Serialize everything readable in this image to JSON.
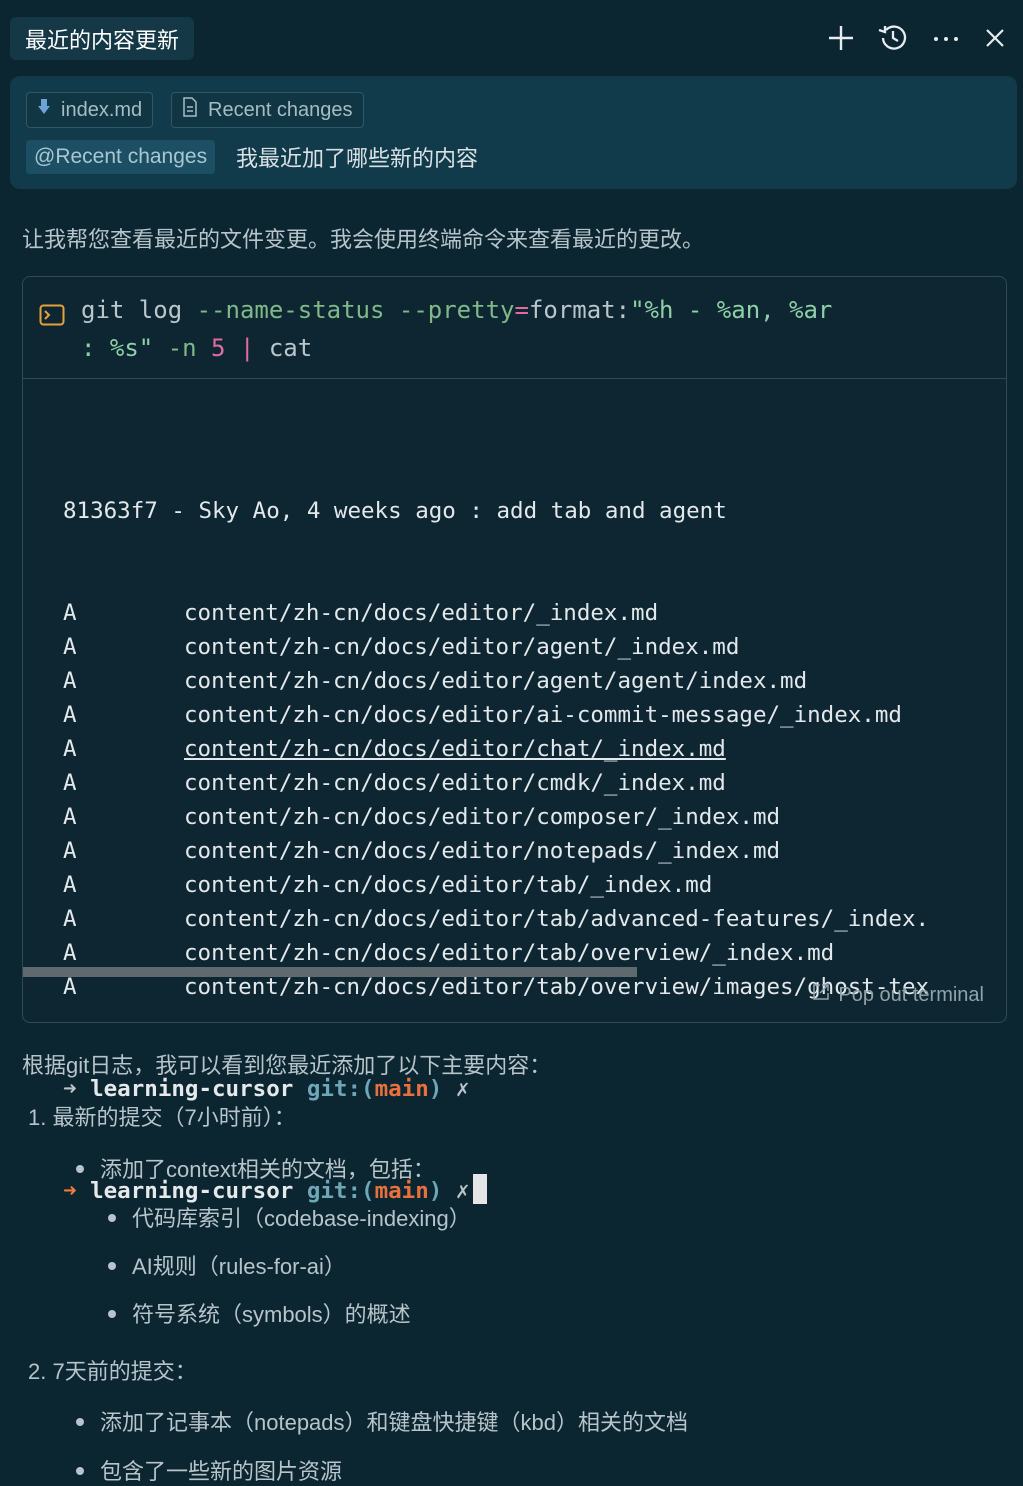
{
  "header": {
    "title": "最近的内容更新",
    "icons": [
      "plus-icon",
      "history-icon",
      "more-icon",
      "close-icon"
    ]
  },
  "user_message": {
    "chips": [
      {
        "icon": "arrow-down-icon",
        "label": "index.md"
      },
      {
        "icon": "document-icon",
        "label": "Recent changes"
      }
    ],
    "mention": "@Recent changes",
    "text": "我最近加了哪些新的内容"
  },
  "assistant": {
    "intro": "让我帮您查看最近的文件变更。我会使用终端命令来查看最近的更改。",
    "terminal": {
      "cmd_line1_a": "git log ",
      "cmd_line1_b": "--name-status --pretty",
      "cmd_line1_c": "=",
      "cmd_line1_d": "format:",
      "cmd_line1_e": "\"%h - %an, %ar",
      "cmd_line2_a": ": %s\"",
      "cmd_line2_b": " -n ",
      "cmd_line2_c": "5",
      "cmd_line2_d": " | ",
      "cmd_line2_e": "cat",
      "commit_line": "81363f7 - Sky Ao, 4 weeks ago : add tab and agent",
      "files": [
        {
          "status": "A",
          "path": "content/zh-cn/docs/editor/_index.md"
        },
        {
          "status": "A",
          "path": "content/zh-cn/docs/editor/agent/_index.md"
        },
        {
          "status": "A",
          "path": "content/zh-cn/docs/editor/agent/agent/index.md"
        },
        {
          "status": "A",
          "path": "content/zh-cn/docs/editor/ai-commit-message/_index.md"
        },
        {
          "status": "A",
          "path": "content/zh-cn/docs/editor/chat/_index.md"
        },
        {
          "status": "A",
          "path": "content/zh-cn/docs/editor/cmdk/_index.md"
        },
        {
          "status": "A",
          "path": "content/zh-cn/docs/editor/composer/_index.md"
        },
        {
          "status": "A",
          "path": "content/zh-cn/docs/editor/notepads/_index.md"
        },
        {
          "status": "A",
          "path": "content/zh-cn/docs/editor/tab/_index.md"
        },
        {
          "status": "A",
          "path": "content/zh-cn/docs/editor/tab/advanced-features/_index."
        },
        {
          "status": "A",
          "path": "content/zh-cn/docs/editor/tab/overview/_index.md"
        },
        {
          "status": "A",
          "path": "content/zh-cn/docs/editor/tab/overview/images/ghost-tex"
        }
      ],
      "prompt_arrow": "➜",
      "prompt_dir": "learning-cursor",
      "prompt_git": "git:(",
      "prompt_branch": "main",
      "prompt_close": ")",
      "prompt_x": "✗",
      "popout_label": "Pop out terminal"
    },
    "summary": "根据git日志，我可以看到您最近添加了以下主要内容：",
    "item1": "1. 最新的提交（7小时前）：",
    "item1_bullet": "添加了context相关的文档，包括：",
    "item1_sub": [
      "代码库索引（codebase-indexing）",
      "AI规则（rules-for-ai）",
      "符号系统（symbols）的概述"
    ],
    "item2": "2. 7天前的提交：",
    "item2_bullets": [
      "添加了记事本（notepads）和键盘快捷键（kbd）相关的文档",
      "包含了一些新的图片资源"
    ]
  }
}
